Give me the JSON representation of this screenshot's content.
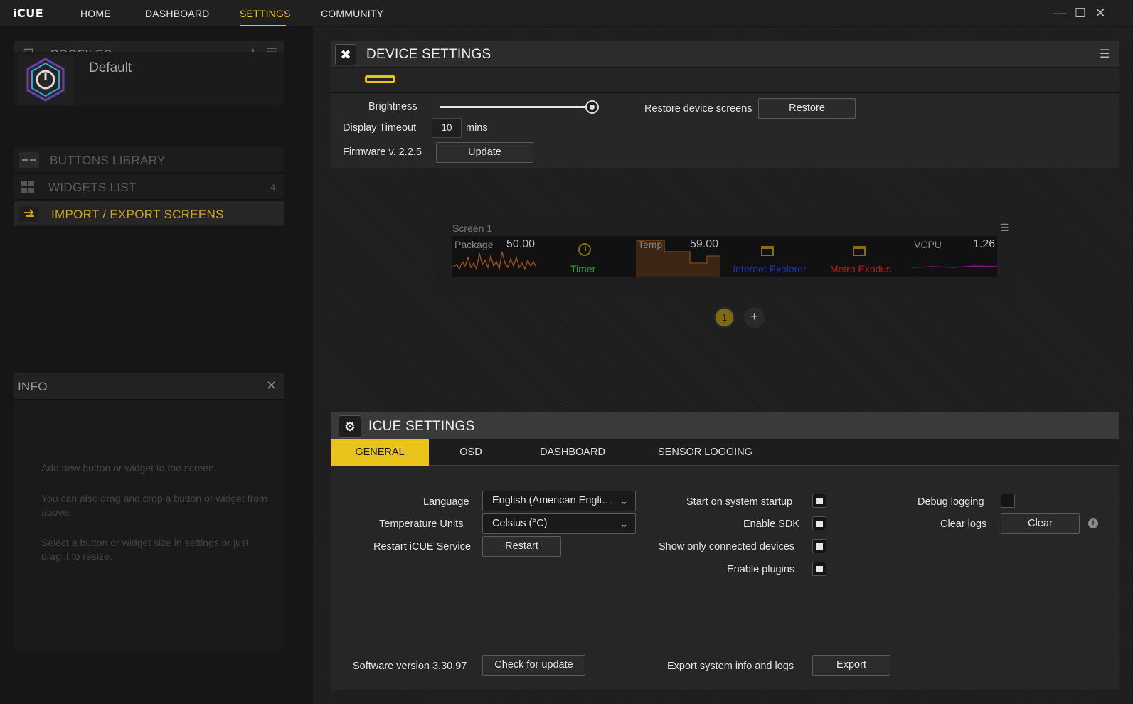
{
  "app": {
    "logo": "iCUE"
  },
  "nav": [
    {
      "label": "HOME"
    },
    {
      "label": "DASHBOARD"
    },
    {
      "label": "SETTINGS"
    },
    {
      "label": "COMMUNITY"
    }
  ],
  "sidebar": {
    "profiles_title": "PROFILES",
    "profile_name": "Default",
    "buttons_library": "BUTTONS LIBRARY",
    "widgets_list": "WIDGETS LIST",
    "widgets_count": "4",
    "import_export": "IMPORT / EXPORT SCREENS",
    "info_title": "INFO",
    "info_lines": [
      "Add new button or widget to the screen.",
      "You can also drag and drop a button or widget from above.",
      "Select a button or widget size in settings or just drag it to resize."
    ]
  },
  "device_settings": {
    "title": "DEVICE SETTINGS",
    "brightness_label": "Brightness",
    "brightness_fraction": 0.99,
    "display_timeout_label": "Display Timeout",
    "display_timeout_value": "10",
    "display_timeout_unit": "mins",
    "firmware_label": "Firmware v. 2.2.5",
    "update_button": "Update",
    "restore_label": "Restore device screens",
    "restore_button": "Restore"
  },
  "screen": {
    "title": "Screen 1",
    "widgets": [
      {
        "label": "Package",
        "value": "50.00"
      },
      {
        "label": "Timer"
      },
      {
        "label": "Temp",
        "value": "59.00"
      },
      {
        "label": "Internet Explorer"
      },
      {
        "label": "Metro Exodus"
      },
      {
        "label": "VCPU",
        "value": "1.26"
      }
    ],
    "page_number": "1",
    "add_page": "+"
  },
  "icue_settings": {
    "title": "ICUE SETTINGS",
    "tabs": [
      {
        "label": "GENERAL"
      },
      {
        "label": "OSD"
      },
      {
        "label": "DASHBOARD"
      },
      {
        "label": "SENSOR LOGGING"
      }
    ],
    "language_label": "Language",
    "language_value": "English (American Engli…",
    "temp_units_label": "Temperature Units",
    "temp_units_value": "Celsius (°C)",
    "restart_label": "Restart iCUE Service",
    "restart_button": "Restart",
    "startup_label": "Start on system startup",
    "sdk_label": "Enable SDK",
    "connected_label": "Show only connected devices",
    "plugins_label": "Enable plugins",
    "debug_label": "Debug logging",
    "clear_logs_label": "Clear logs",
    "clear_button": "Clear",
    "software_version_label": "Software version 3.30.97",
    "check_update_button": "Check for update",
    "export_label": "Export system info and logs",
    "export_button": "Export"
  },
  "colors": {
    "accent": "#e8c31a",
    "timer_green": "#2aa52a",
    "ie_blue": "#1a2fd0",
    "metro_red": "#c01818"
  }
}
